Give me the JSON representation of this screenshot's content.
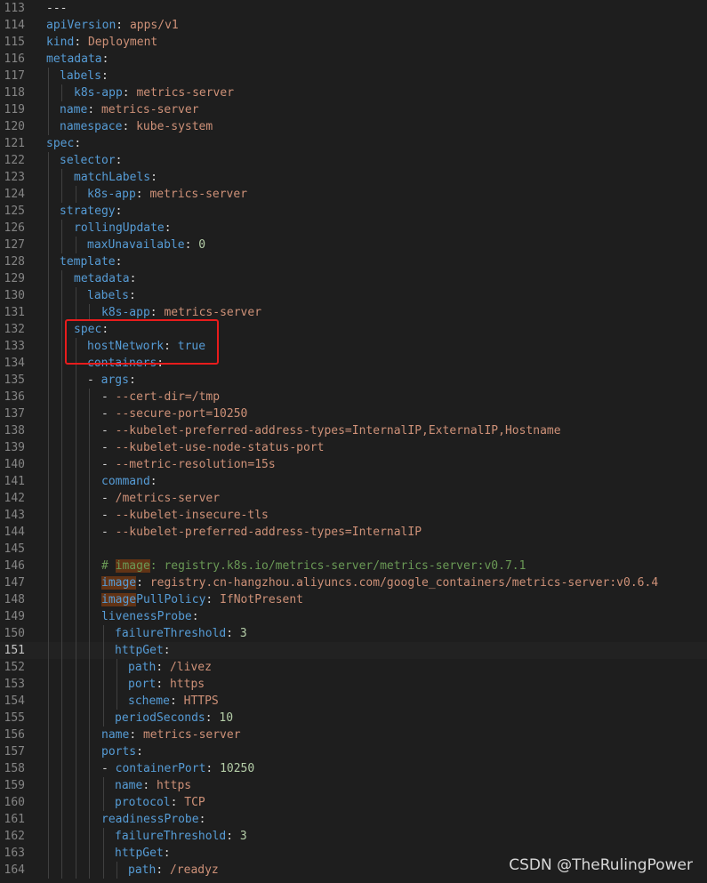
{
  "editor": {
    "active_line": "151",
    "lines": [
      {
        "n": "113",
        "indent": 0,
        "tokens": [
          [
            "p",
            "---"
          ]
        ]
      },
      {
        "n": "114",
        "indent": 0,
        "tokens": [
          [
            "k",
            "apiVersion"
          ],
          [
            "p",
            ": "
          ],
          [
            "s",
            "apps/v1"
          ]
        ]
      },
      {
        "n": "115",
        "indent": 0,
        "tokens": [
          [
            "k",
            "kind"
          ],
          [
            "p",
            ": "
          ],
          [
            "s",
            "Deployment"
          ]
        ]
      },
      {
        "n": "116",
        "indent": 0,
        "tokens": [
          [
            "k",
            "metadata"
          ],
          [
            "p",
            ":"
          ]
        ]
      },
      {
        "n": "117",
        "indent": 1,
        "tokens": [
          [
            "k",
            "labels"
          ],
          [
            "p",
            ":"
          ]
        ]
      },
      {
        "n": "118",
        "indent": 2,
        "tokens": [
          [
            "k",
            "k8s-app"
          ],
          [
            "p",
            ": "
          ],
          [
            "s",
            "metrics-server"
          ]
        ]
      },
      {
        "n": "119",
        "indent": 1,
        "tokens": [
          [
            "k",
            "name"
          ],
          [
            "p",
            ": "
          ],
          [
            "s",
            "metrics-server"
          ]
        ]
      },
      {
        "n": "120",
        "indent": 1,
        "tokens": [
          [
            "k",
            "namespace"
          ],
          [
            "p",
            ": "
          ],
          [
            "s",
            "kube-system"
          ]
        ]
      },
      {
        "n": "121",
        "indent": 0,
        "tokens": [
          [
            "k",
            "spec"
          ],
          [
            "p",
            ":"
          ]
        ]
      },
      {
        "n": "122",
        "indent": 1,
        "tokens": [
          [
            "k",
            "selector"
          ],
          [
            "p",
            ":"
          ]
        ]
      },
      {
        "n": "123",
        "indent": 2,
        "tokens": [
          [
            "k",
            "matchLabels"
          ],
          [
            "p",
            ":"
          ]
        ]
      },
      {
        "n": "124",
        "indent": 3,
        "tokens": [
          [
            "k",
            "k8s-app"
          ],
          [
            "p",
            ": "
          ],
          [
            "s",
            "metrics-server"
          ]
        ]
      },
      {
        "n": "125",
        "indent": 1,
        "tokens": [
          [
            "k",
            "strategy"
          ],
          [
            "p",
            ":"
          ]
        ]
      },
      {
        "n": "126",
        "indent": 2,
        "tokens": [
          [
            "k",
            "rollingUpdate"
          ],
          [
            "p",
            ":"
          ]
        ]
      },
      {
        "n": "127",
        "indent": 3,
        "tokens": [
          [
            "k",
            "maxUnavailable"
          ],
          [
            "p",
            ": "
          ],
          [
            "n",
            "0"
          ]
        ]
      },
      {
        "n": "128",
        "indent": 1,
        "tokens": [
          [
            "k",
            "template"
          ],
          [
            "p",
            ":"
          ]
        ]
      },
      {
        "n": "129",
        "indent": 2,
        "tokens": [
          [
            "k",
            "metadata"
          ],
          [
            "p",
            ":"
          ]
        ]
      },
      {
        "n": "130",
        "indent": 3,
        "tokens": [
          [
            "k",
            "labels"
          ],
          [
            "p",
            ":"
          ]
        ]
      },
      {
        "n": "131",
        "indent": 4,
        "tokens": [
          [
            "k",
            "k8s-app"
          ],
          [
            "p",
            ": "
          ],
          [
            "s",
            "metrics-server"
          ]
        ]
      },
      {
        "n": "132",
        "indent": 2,
        "tokens": [
          [
            "k",
            "spec"
          ],
          [
            "p",
            ":"
          ]
        ]
      },
      {
        "n": "133",
        "indent": 3,
        "tokens": [
          [
            "k",
            "hostNetwork"
          ],
          [
            "p",
            ": "
          ],
          [
            "k",
            "true"
          ]
        ]
      },
      {
        "n": "134",
        "indent": 3,
        "tokens": [
          [
            "k",
            "containers"
          ],
          [
            "p",
            ":"
          ]
        ]
      },
      {
        "n": "135",
        "indent": 3,
        "tokens": [
          [
            "p",
            "- "
          ],
          [
            "k",
            "args"
          ],
          [
            "p",
            ":"
          ]
        ]
      },
      {
        "n": "136",
        "indent": 4,
        "tokens": [
          [
            "p",
            "- "
          ],
          [
            "s",
            "--cert-dir=/tmp"
          ]
        ]
      },
      {
        "n": "137",
        "indent": 4,
        "tokens": [
          [
            "p",
            "- "
          ],
          [
            "s",
            "--secure-port=10250"
          ]
        ]
      },
      {
        "n": "138",
        "indent": 4,
        "tokens": [
          [
            "p",
            "- "
          ],
          [
            "s",
            "--kubelet-preferred-address-types=InternalIP,ExternalIP,Hostname"
          ]
        ]
      },
      {
        "n": "139",
        "indent": 4,
        "tokens": [
          [
            "p",
            "- "
          ],
          [
            "s",
            "--kubelet-use-node-status-port"
          ]
        ]
      },
      {
        "n": "140",
        "indent": 4,
        "tokens": [
          [
            "p",
            "- "
          ],
          [
            "s",
            "--metric-resolution=15s"
          ]
        ]
      },
      {
        "n": "141",
        "indent": 4,
        "tokens": [
          [
            "k",
            "command"
          ],
          [
            "p",
            ":"
          ]
        ]
      },
      {
        "n": "142",
        "indent": 4,
        "tokens": [
          [
            "p",
            "- "
          ],
          [
            "s",
            "/metrics-server"
          ]
        ]
      },
      {
        "n": "143",
        "indent": 4,
        "tokens": [
          [
            "p",
            "- "
          ],
          [
            "s",
            "--kubelet-insecure-tls"
          ]
        ]
      },
      {
        "n": "144",
        "indent": 4,
        "tokens": [
          [
            "p",
            "- "
          ],
          [
            "s",
            "--kubelet-preferred-address-types=InternalIP"
          ]
        ]
      },
      {
        "n": "145",
        "indent": 4,
        "tokens": []
      },
      {
        "n": "146",
        "indent": 4,
        "tokens": [
          [
            "c",
            "# "
          ],
          [
            "chl",
            "image"
          ],
          [
            "c",
            ": registry.k8s.io/metrics-server/metrics-server:v0.7.1"
          ]
        ]
      },
      {
        "n": "147",
        "indent": 4,
        "tokens": [
          [
            "khl",
            "image"
          ],
          [
            "p",
            ": "
          ],
          [
            "s",
            "registry.cn-hangzhou.aliyuncs.com/google_containers/metrics-server:v0.6.4"
          ]
        ]
      },
      {
        "n": "148",
        "indent": 4,
        "tokens": [
          [
            "khl",
            "image"
          ],
          [
            "k",
            "PullPolicy"
          ],
          [
            "p",
            ": "
          ],
          [
            "s",
            "IfNotPresent"
          ]
        ]
      },
      {
        "n": "149",
        "indent": 4,
        "tokens": [
          [
            "k",
            "livenessProbe"
          ],
          [
            "p",
            ":"
          ]
        ]
      },
      {
        "n": "150",
        "indent": 5,
        "tokens": [
          [
            "k",
            "failureThreshold"
          ],
          [
            "p",
            ": "
          ],
          [
            "n",
            "3"
          ]
        ]
      },
      {
        "n": "151",
        "indent": 5,
        "tokens": [
          [
            "k",
            "httpGet"
          ],
          [
            "p",
            ":"
          ]
        ]
      },
      {
        "n": "152",
        "indent": 6,
        "tokens": [
          [
            "k",
            "path"
          ],
          [
            "p",
            ": "
          ],
          [
            "s",
            "/livez"
          ]
        ]
      },
      {
        "n": "153",
        "indent": 6,
        "tokens": [
          [
            "k",
            "port"
          ],
          [
            "p",
            ": "
          ],
          [
            "s",
            "https"
          ]
        ]
      },
      {
        "n": "154",
        "indent": 6,
        "tokens": [
          [
            "k",
            "scheme"
          ],
          [
            "p",
            ": "
          ],
          [
            "s",
            "HTTPS"
          ]
        ]
      },
      {
        "n": "155",
        "indent": 5,
        "tokens": [
          [
            "k",
            "periodSeconds"
          ],
          [
            "p",
            ": "
          ],
          [
            "n",
            "10"
          ]
        ]
      },
      {
        "n": "156",
        "indent": 4,
        "tokens": [
          [
            "k",
            "name"
          ],
          [
            "p",
            ": "
          ],
          [
            "s",
            "metrics-server"
          ]
        ]
      },
      {
        "n": "157",
        "indent": 4,
        "tokens": [
          [
            "k",
            "ports"
          ],
          [
            "p",
            ":"
          ]
        ]
      },
      {
        "n": "158",
        "indent": 4,
        "tokens": [
          [
            "p",
            "- "
          ],
          [
            "k",
            "containerPort"
          ],
          [
            "p",
            ": "
          ],
          [
            "n",
            "10250"
          ]
        ]
      },
      {
        "n": "159",
        "indent": 5,
        "tokens": [
          [
            "k",
            "name"
          ],
          [
            "p",
            ": "
          ],
          [
            "s",
            "https"
          ]
        ]
      },
      {
        "n": "160",
        "indent": 5,
        "tokens": [
          [
            "k",
            "protocol"
          ],
          [
            "p",
            ": "
          ],
          [
            "s",
            "TCP"
          ]
        ]
      },
      {
        "n": "161",
        "indent": 4,
        "tokens": [
          [
            "k",
            "readinessProbe"
          ],
          [
            "p",
            ":"
          ]
        ]
      },
      {
        "n": "162",
        "indent": 5,
        "tokens": [
          [
            "k",
            "failureThreshold"
          ],
          [
            "p",
            ": "
          ],
          [
            "n",
            "3"
          ]
        ]
      },
      {
        "n": "163",
        "indent": 5,
        "tokens": [
          [
            "k",
            "httpGet"
          ],
          [
            "p",
            ":"
          ]
        ]
      },
      {
        "n": "164",
        "indent": 6,
        "tokens": [
          [
            "k",
            "path"
          ],
          [
            "p",
            ": "
          ],
          [
            "s",
            "/readyz"
          ]
        ]
      }
    ]
  },
  "watermark": "CSDN @TheRulingPower",
  "colors": {
    "background": "#1e1e1e",
    "key": "#569cd6",
    "string": "#ce9178",
    "number": "#b5cea8",
    "comment": "#6a9955",
    "punctuation": "#d4d4d4",
    "line_number": "#858585",
    "highlight_box": "#e81c1c",
    "word_highlight": "#613315"
  }
}
